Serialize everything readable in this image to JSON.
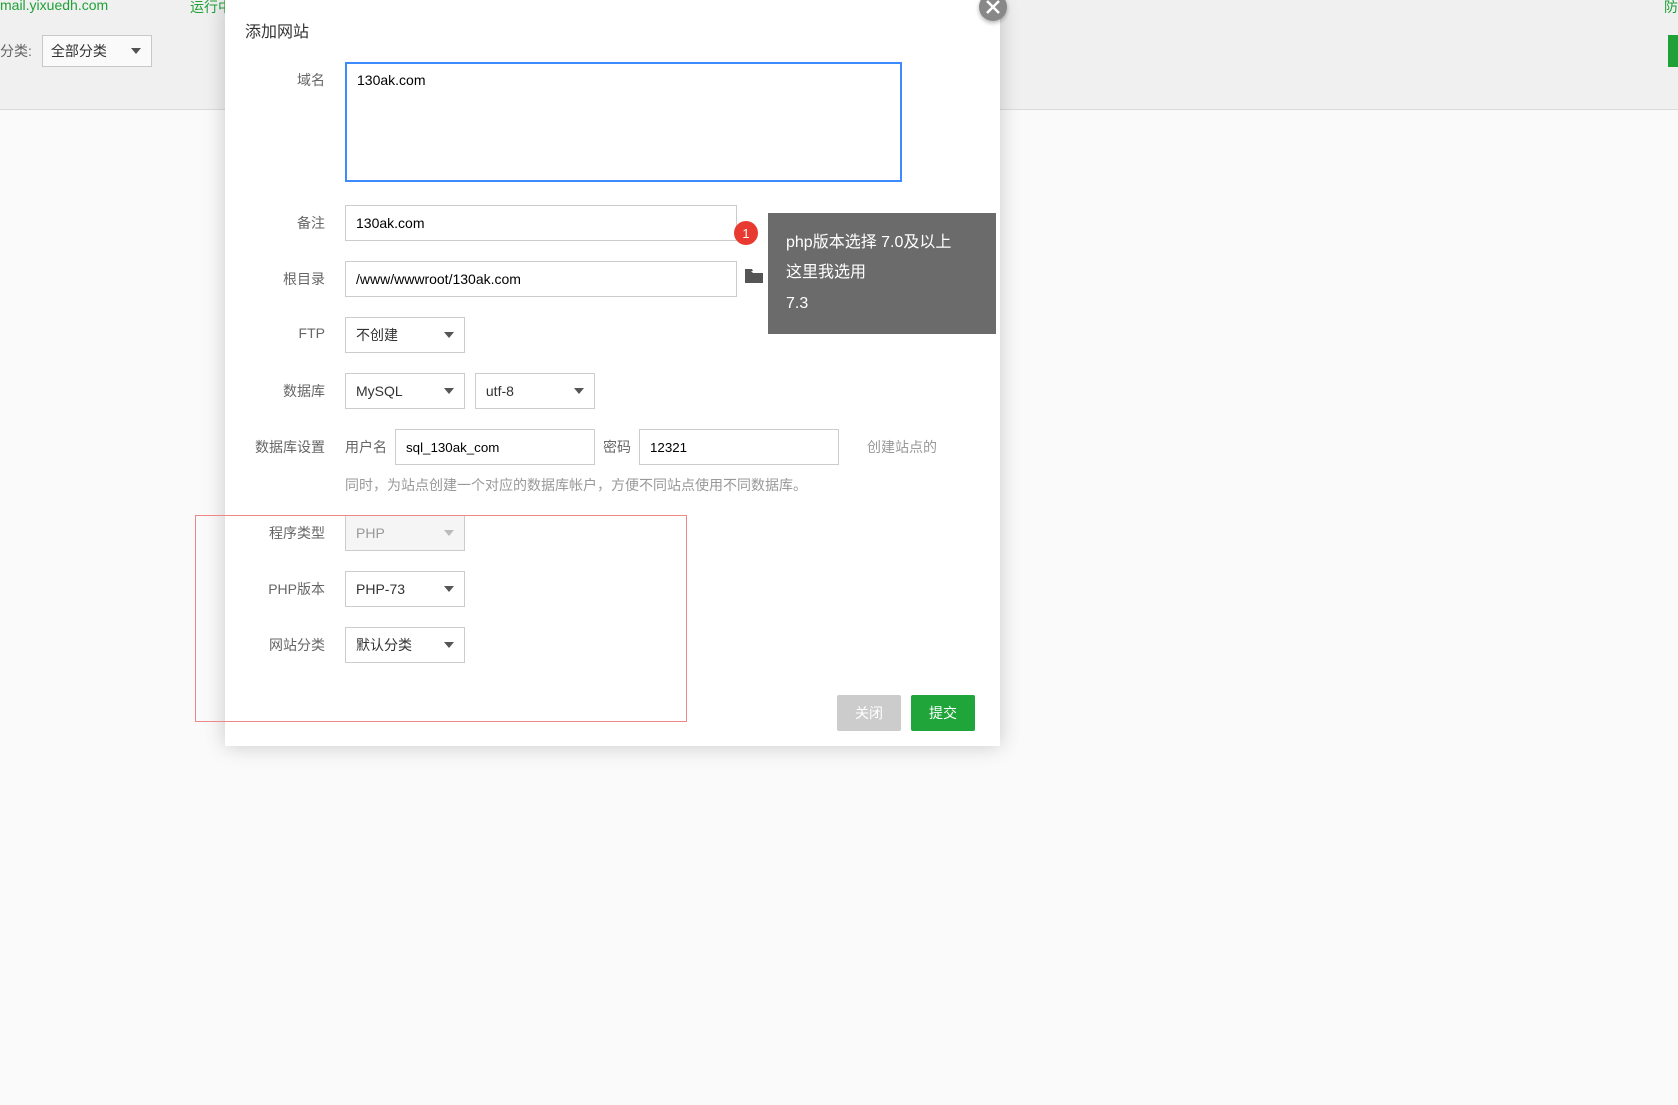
{
  "background": {
    "site_link": "mail.yixuedh.com",
    "running_text": "运行中",
    "right_text": "防",
    "filter_label": "分类:",
    "filter_value": "全部分类"
  },
  "modal": {
    "title": "添加网站",
    "labels": {
      "domain": "域名",
      "remark": "备注",
      "root": "根目录",
      "ftp": "FTP",
      "database": "数据库",
      "db_settings": "数据库设置",
      "program_type": "程序类型",
      "php_version": "PHP版本",
      "site_category": "网站分类"
    },
    "values": {
      "domain": "130ak.com",
      "remark": "130ak.com",
      "root": "/www/wwwroot/130ak.com",
      "ftp": "不创建",
      "db_type": "MySQL",
      "db_charset": "utf-8",
      "db_user_label": "用户名",
      "db_user": "sql_130ak_com",
      "db_pass_label": "密码",
      "db_pass": "12321",
      "db_hint_inline": "创建站点的",
      "db_hint_below": "同时，为站点创建一个对应的数据库帐户，方便不同站点使用不同数据库。",
      "program_type": "PHP",
      "php_version": "PHP-73",
      "site_category": "默认分类"
    },
    "buttons": {
      "close": "关闭",
      "submit": "提交"
    }
  },
  "annotation": {
    "badge": "1",
    "line1": "php版本选择 7.0及以上",
    "line2": "这里我选用",
    "line3": "7.3"
  }
}
